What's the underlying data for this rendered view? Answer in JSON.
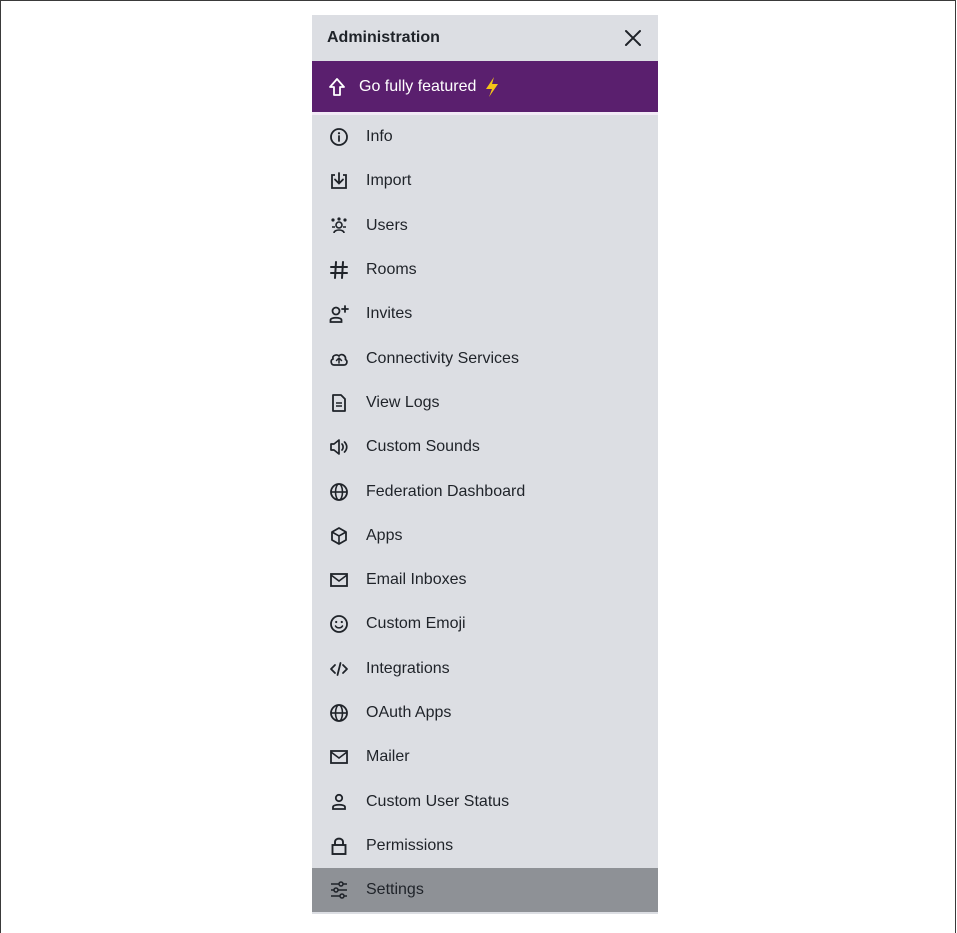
{
  "panel": {
    "title": "Administration"
  },
  "upgrade": {
    "label": "Go fully featured",
    "bolt_color": "#f5c518",
    "background": "#5a1f6e"
  },
  "menu": {
    "items": [
      {
        "label": "Info",
        "icon": "info-icon"
      },
      {
        "label": "Import",
        "icon": "import-icon"
      },
      {
        "label": "Users",
        "icon": "users-icon"
      },
      {
        "label": "Rooms",
        "icon": "hashtag-icon"
      },
      {
        "label": "Invites",
        "icon": "user-plus-icon"
      },
      {
        "label": "Connectivity Services",
        "icon": "cloud-icon"
      },
      {
        "label": "View Logs",
        "icon": "file-icon"
      },
      {
        "label": "Custom Sounds",
        "icon": "speaker-icon"
      },
      {
        "label": "Federation Dashboard",
        "icon": "globe-icon"
      },
      {
        "label": "Apps",
        "icon": "cube-icon"
      },
      {
        "label": "Email Inboxes",
        "icon": "inbox-icon"
      },
      {
        "label": "Custom Emoji",
        "icon": "emoji-icon"
      },
      {
        "label": "Integrations",
        "icon": "code-icon"
      },
      {
        "label": "OAuth Apps",
        "icon": "globe-icon"
      },
      {
        "label": "Mailer",
        "icon": "mail-icon"
      },
      {
        "label": "Custom User Status",
        "icon": "user-icon"
      },
      {
        "label": "Permissions",
        "icon": "lock-icon"
      },
      {
        "label": "Settings",
        "icon": "sliders-icon",
        "active": true
      }
    ]
  }
}
